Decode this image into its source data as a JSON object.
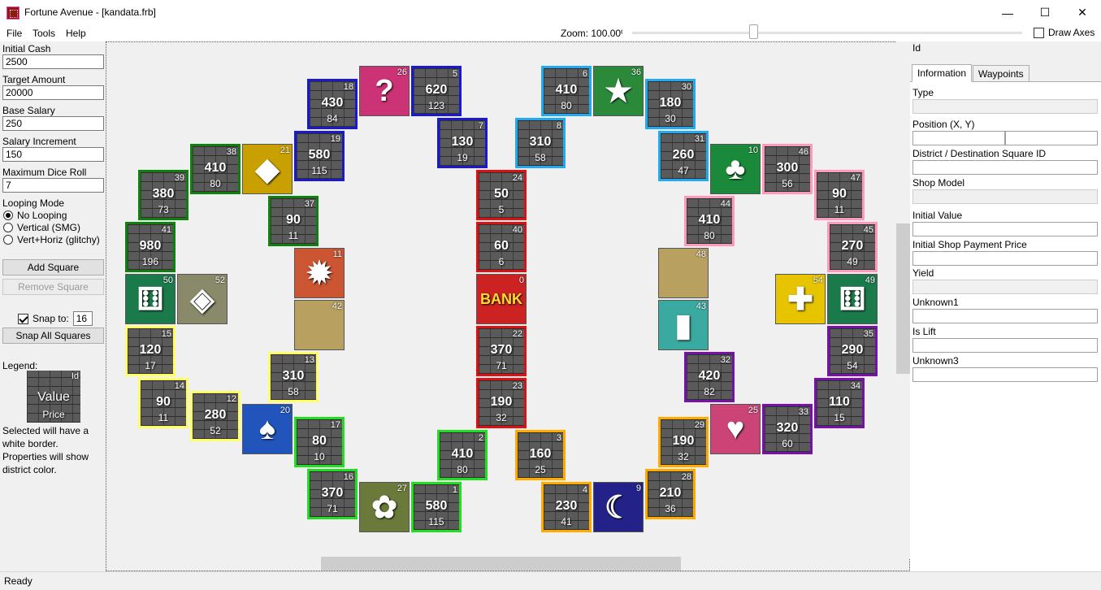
{
  "window": {
    "title": "Fortune Avenue - [kandata.frb]",
    "minimize": "—",
    "maximize": "☐",
    "close": "✕"
  },
  "menu": {
    "file": "File",
    "tools": "Tools",
    "help": "Help"
  },
  "zoom": {
    "label": "Zoom: 100.00%",
    "value": 100
  },
  "draw_axes": {
    "label": "Draw Axes",
    "checked": false
  },
  "left": {
    "initial_cash_label": "Initial Cash",
    "initial_cash": "2500",
    "target_amount_label": "Target Amount",
    "target_amount": "20000",
    "base_salary_label": "Base Salary",
    "base_salary": "250",
    "salary_increment_label": "Salary Increment",
    "salary_increment": "150",
    "max_dice_label": "Maximum Dice Roll",
    "max_dice": "7",
    "looping_label": "Looping Mode",
    "loop_options": [
      "No Looping",
      "Vertical (SMG)",
      "Vert+Horiz (glitchy)"
    ],
    "add_square": "Add Square",
    "remove_square": "Remove Square",
    "snap_label": "Snap to:",
    "snap_value": "16",
    "snap_all": "Snap All Squares",
    "legend_label": "Legend:",
    "legend_id": "Id",
    "legend_value": "Value",
    "legend_price": "Price",
    "legend_note1": "Selected will have a",
    "legend_note2": "white border.",
    "legend_note3": "Properties will show",
    "legend_note4": "district color."
  },
  "right": {
    "id_label": "Id",
    "tab_info": "Information",
    "tab_waypoints": "Waypoints",
    "type": "Type",
    "position": "Position (X, Y)",
    "district": "District / Destination Square ID",
    "shop_model": "Shop Model",
    "initial_value": "Initial Value",
    "initial_shop_payment": "Initial Shop Payment Price",
    "yield": "Yield",
    "unknown1": "Unknown1",
    "is_lift": "Is Lift",
    "unknown3": "Unknown3"
  },
  "status": "Ready",
  "colors": {
    "blue": "#1a1acc",
    "green": "#0f7f0f",
    "lime": "#22dd22",
    "red": "#dd1111",
    "yellow": "#ffff66",
    "lightblue": "#22aaee",
    "pink": "#ff99bb",
    "purple": "#7711aa",
    "orange": "#ffaa00",
    "olive": "#1a7a1a"
  },
  "squares": [
    {
      "id": "18",
      "value": "430",
      "price": "84",
      "color": "#1a1acc",
      "type": "shop"
    },
    {
      "id": "26",
      "type": "question",
      "color": "#cc3377"
    },
    {
      "id": "5",
      "value": "620",
      "price": "123",
      "color": "#1a1acc",
      "type": "shop"
    },
    {
      "id": "6",
      "value": "410",
      "price": "80",
      "color": "#22aaee",
      "type": "shop"
    },
    {
      "id": "36",
      "type": "star",
      "color": "#2a8a3a"
    },
    {
      "id": "30",
      "value": "180",
      "price": "30",
      "color": "#22aaee",
      "type": "shop"
    },
    {
      "id": "7",
      "value": "130",
      "price": "19",
      "color": "#1a1acc",
      "type": "shop"
    },
    {
      "id": "8",
      "value": "310",
      "price": "58",
      "color": "#22aaee",
      "type": "shop"
    },
    {
      "id": "38",
      "value": "410",
      "price": "80",
      "color": "#0f7f0f",
      "type": "shop"
    },
    {
      "id": "21",
      "type": "diamond",
      "color": "#c8a000"
    },
    {
      "id": "19",
      "value": "580",
      "price": "115",
      "color": "#1a1acc",
      "type": "shop"
    },
    {
      "id": "24",
      "value": "50",
      "price": "5",
      "color": "#dd1111",
      "type": "shop"
    },
    {
      "id": "31",
      "value": "260",
      "price": "47",
      "color": "#22aaee",
      "type": "shop"
    },
    {
      "id": "10",
      "type": "club",
      "color": "#1a8a3a"
    },
    {
      "id": "46",
      "value": "300",
      "price": "56",
      "color": "#ff99bb",
      "type": "shop"
    },
    {
      "id": "47",
      "value": "90",
      "price": "11",
      "color": "#ff99bb",
      "type": "shop"
    },
    {
      "id": "39",
      "value": "380",
      "price": "73",
      "color": "#0f7f0f",
      "type": "shop"
    },
    {
      "id": "37",
      "value": "90",
      "price": "11",
      "color": "#0f7f0f",
      "type": "shop"
    },
    {
      "id": "40",
      "value": "60",
      "price": "6",
      "color": "#dd1111",
      "type": "shop"
    },
    {
      "id": "44",
      "value": "410",
      "price": "80",
      "color": "#ff99bb",
      "type": "shop"
    },
    {
      "id": "41",
      "value": "980",
      "price": "196",
      "color": "#0f7f0f",
      "type": "shop"
    },
    {
      "id": "45",
      "value": "270",
      "price": "49",
      "color": "#ff99bb",
      "type": "shop"
    },
    {
      "id": "11",
      "type": "sun",
      "color": "#cc5533"
    },
    {
      "id": "48",
      "type": "sand",
      "color": "#b8a060"
    },
    {
      "id": "50",
      "type": "dice",
      "color": "#1a7a4a"
    },
    {
      "id": "52",
      "type": "warp",
      "color": "#8a8a6a"
    },
    {
      "id": "0",
      "type": "bank",
      "color": "#cc2222"
    },
    {
      "id": "54",
      "type": "cross",
      "color": "#e6c400"
    },
    {
      "id": "49",
      "type": "dice",
      "color": "#1a7a4a"
    },
    {
      "id": "42",
      "type": "sand",
      "color": "#b8a060"
    },
    {
      "id": "43",
      "type": "lift",
      "color": "#3aaaa0"
    },
    {
      "id": "15",
      "value": "120",
      "price": "17",
      "color": "#ffff66",
      "type": "shop"
    },
    {
      "id": "22",
      "value": "370",
      "price": "71",
      "color": "#dd1111",
      "type": "shop"
    },
    {
      "id": "35",
      "value": "290",
      "price": "54",
      "color": "#7711aa",
      "type": "shop"
    },
    {
      "id": "13",
      "value": "310",
      "price": "58",
      "color": "#ffff66",
      "type": "shop"
    },
    {
      "id": "32",
      "value": "420",
      "price": "82",
      "color": "#7711aa",
      "type": "shop"
    },
    {
      "id": "14",
      "value": "90",
      "price": "11",
      "color": "#ffff66",
      "type": "shop"
    },
    {
      "id": "12",
      "value": "280",
      "price": "52",
      "color": "#ffff66",
      "type": "shop"
    },
    {
      "id": "20",
      "type": "spade",
      "color": "#2255bb"
    },
    {
      "id": "23",
      "value": "190",
      "price": "32",
      "color": "#dd1111",
      "type": "shop"
    },
    {
      "id": "25",
      "type": "heart",
      "color": "#cc4477"
    },
    {
      "id": "33",
      "value": "320",
      "price": "60",
      "color": "#7711aa",
      "type": "shop"
    },
    {
      "id": "34",
      "value": "110",
      "price": "15",
      "color": "#7711aa",
      "type": "shop"
    },
    {
      "id": "17",
      "value": "80",
      "price": "10",
      "color": "#22dd22",
      "type": "shop"
    },
    {
      "id": "2",
      "value": "410",
      "price": "80",
      "color": "#22dd22",
      "type": "shop"
    },
    {
      "id": "3",
      "value": "160",
      "price": "25",
      "color": "#ffaa00",
      "type": "shop"
    },
    {
      "id": "29",
      "value": "190",
      "price": "32",
      "color": "#ffaa00",
      "type": "shop"
    },
    {
      "id": "16",
      "value": "370",
      "price": "71",
      "color": "#22dd22",
      "type": "shop"
    },
    {
      "id": "27",
      "type": "treasure",
      "color": "#6a7a3a"
    },
    {
      "id": "1",
      "value": "580",
      "price": "115",
      "color": "#22dd22",
      "type": "shop"
    },
    {
      "id": "4",
      "value": "230",
      "price": "41",
      "color": "#ffaa00",
      "type": "shop"
    },
    {
      "id": "9",
      "type": "moon",
      "color": "#222288"
    },
    {
      "id": "28",
      "value": "210",
      "price": "36",
      "color": "#ffaa00",
      "type": "shop"
    }
  ]
}
